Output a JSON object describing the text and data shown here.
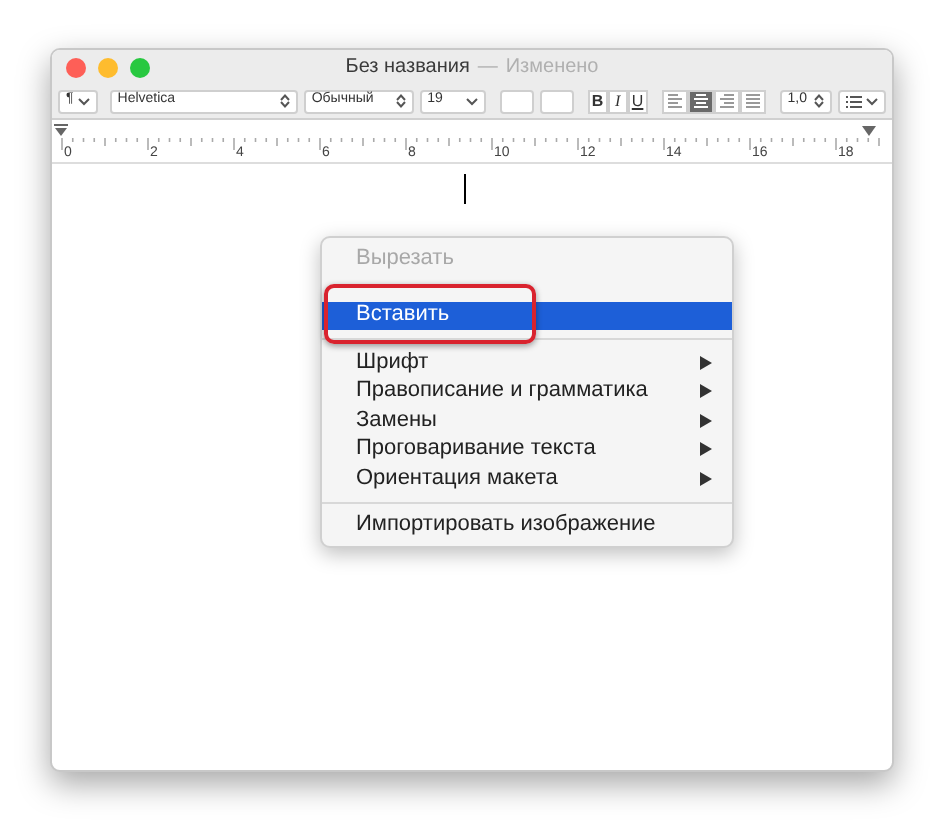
{
  "window": {
    "title": "Без названия",
    "separator": "—",
    "status": "Изменено"
  },
  "toolbar": {
    "paragraph_style": "¶",
    "font": "Helvetica",
    "typeface": "Обычный",
    "size": "19",
    "style_buttons": [
      {
        "label": "B",
        "kind": "bold"
      },
      {
        "label": "I",
        "kind": "italic"
      },
      {
        "label": "U",
        "kind": "underline"
      }
    ],
    "alignment": [
      {
        "kind": "left",
        "selected": false
      },
      {
        "kind": "center",
        "selected": true
      },
      {
        "kind": "right",
        "selected": false
      },
      {
        "kind": "justify",
        "selected": false
      }
    ],
    "spacing": "1,0"
  },
  "ruler": {
    "labels": [
      "0",
      "2",
      "4",
      "6",
      "8",
      "10",
      "12",
      "14",
      "16",
      "18"
    ]
  },
  "context_menu": {
    "items": [
      {
        "kind": "item",
        "label": "Вырезать",
        "disabled": true,
        "selected": false,
        "submenu": false
      },
      {
        "kind": "item",
        "label": "Вставить",
        "disabled": false,
        "selected": true,
        "submenu": false,
        "highlighted": true
      },
      {
        "kind": "separator"
      },
      {
        "kind": "item",
        "label": "Шрифт",
        "disabled": false,
        "selected": false,
        "submenu": true
      },
      {
        "kind": "item",
        "label": "Правописание и грамматика",
        "disabled": false,
        "selected": false,
        "submenu": true
      },
      {
        "kind": "item",
        "label": "Замены",
        "disabled": false,
        "selected": false,
        "submenu": true
      },
      {
        "kind": "item",
        "label": "Проговаривание текста",
        "disabled": false,
        "selected": false,
        "submenu": true
      },
      {
        "kind": "item",
        "label": "Ориентация макета",
        "disabled": false,
        "selected": false,
        "submenu": true
      },
      {
        "kind": "separator"
      },
      {
        "kind": "item",
        "label": "Импортировать изображение",
        "disabled": false,
        "selected": false,
        "submenu": false
      }
    ]
  }
}
